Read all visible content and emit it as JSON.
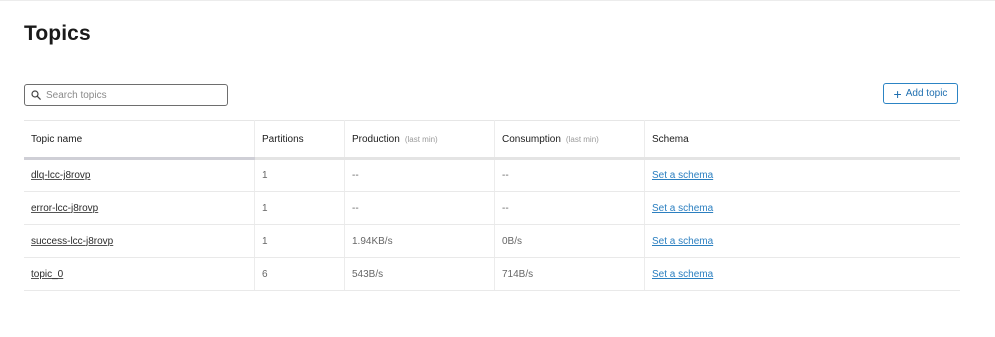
{
  "page": {
    "title": "Topics"
  },
  "search": {
    "placeholder": "Search topics",
    "value": ""
  },
  "toolbar": {
    "add_topic_label": "Add topic"
  },
  "table": {
    "columns": {
      "topic_name": "Topic name",
      "partitions": "Partitions",
      "production": "Production",
      "production_hint": "(last min)",
      "consumption": "Consumption",
      "consumption_hint": "(last min)",
      "schema": "Schema"
    },
    "rows": [
      {
        "name": "dlq-lcc-j8rovp",
        "partitions": "1",
        "production": "--",
        "consumption": "--",
        "schema": "Set a schema"
      },
      {
        "name": "error-lcc-j8rovp",
        "partitions": "1",
        "production": "--",
        "consumption": "--",
        "schema": "Set a schema"
      },
      {
        "name": "success-lcc-j8rovp",
        "partitions": "1",
        "production": "1.94KB/s",
        "consumption": "0B/s",
        "schema": "Set a schema"
      },
      {
        "name": "topic_0",
        "partitions": "6",
        "production": "543B/s",
        "consumption": "714B/s",
        "schema": "Set a schema"
      }
    ]
  },
  "icons": {
    "search": "search-icon",
    "add": "plus-icon"
  },
  "colors": {
    "accent": "#2b7fc0",
    "text": "#1f1f1f",
    "muted": "#9a9a9a"
  }
}
